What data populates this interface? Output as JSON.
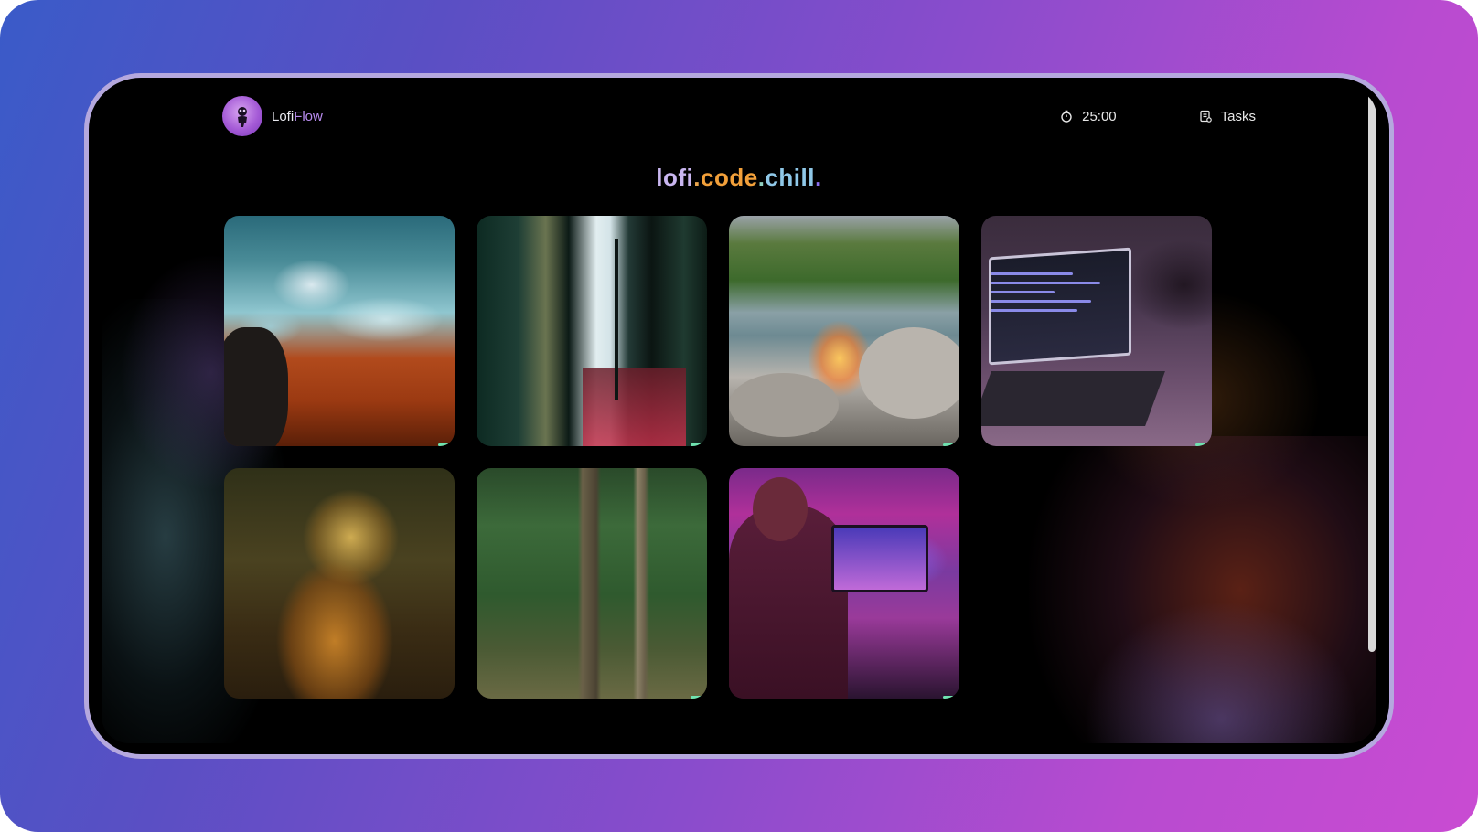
{
  "app": {
    "brand_primary": "Lofi",
    "brand_secondary": "Flow",
    "logo_icon": "character-avatar-icon"
  },
  "nav": {
    "timer": {
      "icon": "stopwatch-icon",
      "value": "25:00"
    },
    "tasks": {
      "icon": "task-list-icon",
      "label": "Tasks"
    }
  },
  "headline": {
    "parts": [
      {
        "text": "lofi",
        "color": "#c9b6f0"
      },
      {
        "text": ".",
        "color": "#e9a54e"
      },
      {
        "text": "code",
        "color": "#f2a03a"
      },
      {
        "text": ".",
        "color": "#8fd0c0"
      },
      {
        "text": "chill",
        "color": "#8fc8e8"
      },
      {
        "text": ".",
        "color": "#8a6ff0"
      }
    ]
  },
  "scenes": [
    {
      "name": "ocean-waves-scene"
    },
    {
      "name": "rainy-alley-scene"
    },
    {
      "name": "campfire-river-scene"
    },
    {
      "name": "laptop-coding-scene"
    },
    {
      "name": "warrior-painting-scene"
    },
    {
      "name": "forest-path-scene"
    },
    {
      "name": "gaming-desk-scene"
    }
  ],
  "colors": {
    "background_gradient_start": "#3a5bc8",
    "background_gradient_end": "#c94bd2",
    "accent": "#b98cf0"
  }
}
